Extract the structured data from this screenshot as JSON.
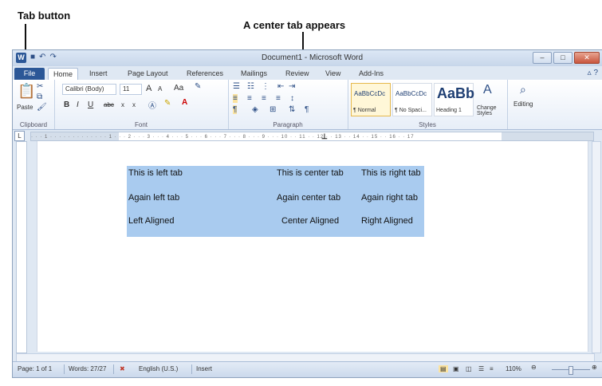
{
  "annotations": {
    "tab_button": "Tab button",
    "center_tab": "A center tab appears"
  },
  "window": {
    "title": "Document1 - Microsoft Word",
    "qat_icons": [
      "word-logo-icon",
      "save-icon",
      "undo-icon",
      "redo-icon"
    ],
    "controls": [
      "minimize-icon",
      "maximize-icon",
      "close-icon"
    ]
  },
  "tabs": [
    "File",
    "Home",
    "Insert",
    "Page Layout",
    "References",
    "Mailings",
    "Review",
    "View",
    "Add-Ins"
  ],
  "ribbon": {
    "clipboard": {
      "label": "Clipboard",
      "paste": "Paste"
    },
    "font": {
      "label": "Font",
      "family": "Calibri (Body)",
      "size": "11",
      "grow": "A",
      "shrink": "A",
      "case": "Aa",
      "bold": "B",
      "italic": "I",
      "underline": "U",
      "strike": "abc",
      "sub": "x",
      "sup": "x"
    },
    "paragraph": {
      "label": "Paragraph"
    },
    "styles": {
      "label": "Styles",
      "items": [
        {
          "sample": "AaBbCcDc",
          "name": "¶ Normal"
        },
        {
          "sample": "AaBbCcDc",
          "name": "¶ No Spaci..."
        },
        {
          "sample": "AaBb",
          "name": "Heading 1"
        }
      ],
      "change": "Change Styles"
    },
    "editing": {
      "label": "Editing"
    }
  },
  "ruler": {
    "tab_button_glyph": "L",
    "tabstop_glyph": "⊥"
  },
  "document": {
    "rows": [
      [
        "This is left tab",
        "This is center tab",
        "This is right tab"
      ],
      [
        "Again left tab",
        "Again center tab",
        "Again right tab"
      ],
      [
        "Left Aligned",
        "Center Aligned",
        "Right Aligned"
      ]
    ]
  },
  "status": {
    "page": "Page: 1 of 1",
    "words": "Words: 27/27",
    "language": "English (U.S.)",
    "mode": "Insert",
    "zoom": "110%"
  },
  "colors": {
    "accent": "#2b5797",
    "selection": "#a9cbef"
  }
}
